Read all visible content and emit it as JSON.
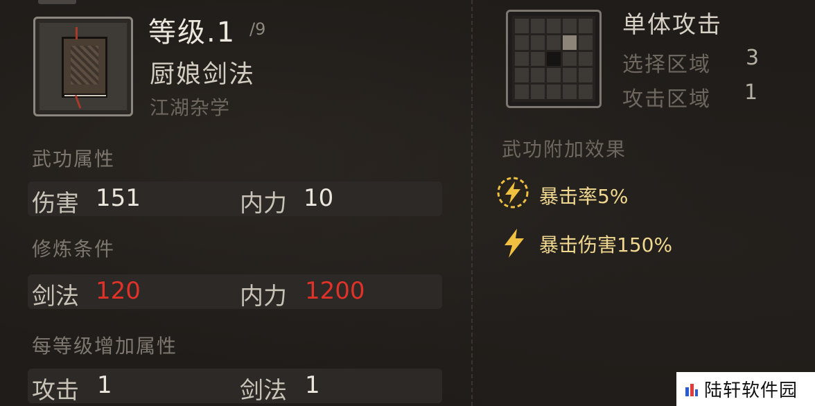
{
  "skill": {
    "level": "等级.1",
    "level_max": "/9",
    "name": "厨娘剑法",
    "category": "江湖杂学"
  },
  "attributes": {
    "title": "武功属性",
    "items": [
      {
        "label": "伤害",
        "value": "151"
      },
      {
        "label": "内力",
        "value": "10"
      }
    ]
  },
  "requirements": {
    "title": "修炼条件",
    "items": [
      {
        "label": "剑法",
        "value": "120"
      },
      {
        "label": "内力",
        "value": "1200"
      }
    ],
    "value_color": "#e03228"
  },
  "per_level": {
    "title": "每等级增加属性",
    "items": [
      {
        "label": "攻击",
        "value": "1"
      },
      {
        "label": "剑法",
        "value": "1"
      }
    ]
  },
  "attack": {
    "type": "单体攻击",
    "select_area_label": "选择区域",
    "select_area_value": "3",
    "attack_area_label": "攻击区域",
    "attack_area_value": "1"
  },
  "effects": {
    "title": "武功附加效果",
    "items": [
      {
        "icon": "lightning-circle-icon",
        "text": "暴击率5%"
      },
      {
        "icon": "lightning-icon",
        "text": "暴击伤害150%"
      }
    ],
    "accent_color": "#f0c040"
  },
  "watermark": {
    "text": "陆轩软件园"
  }
}
